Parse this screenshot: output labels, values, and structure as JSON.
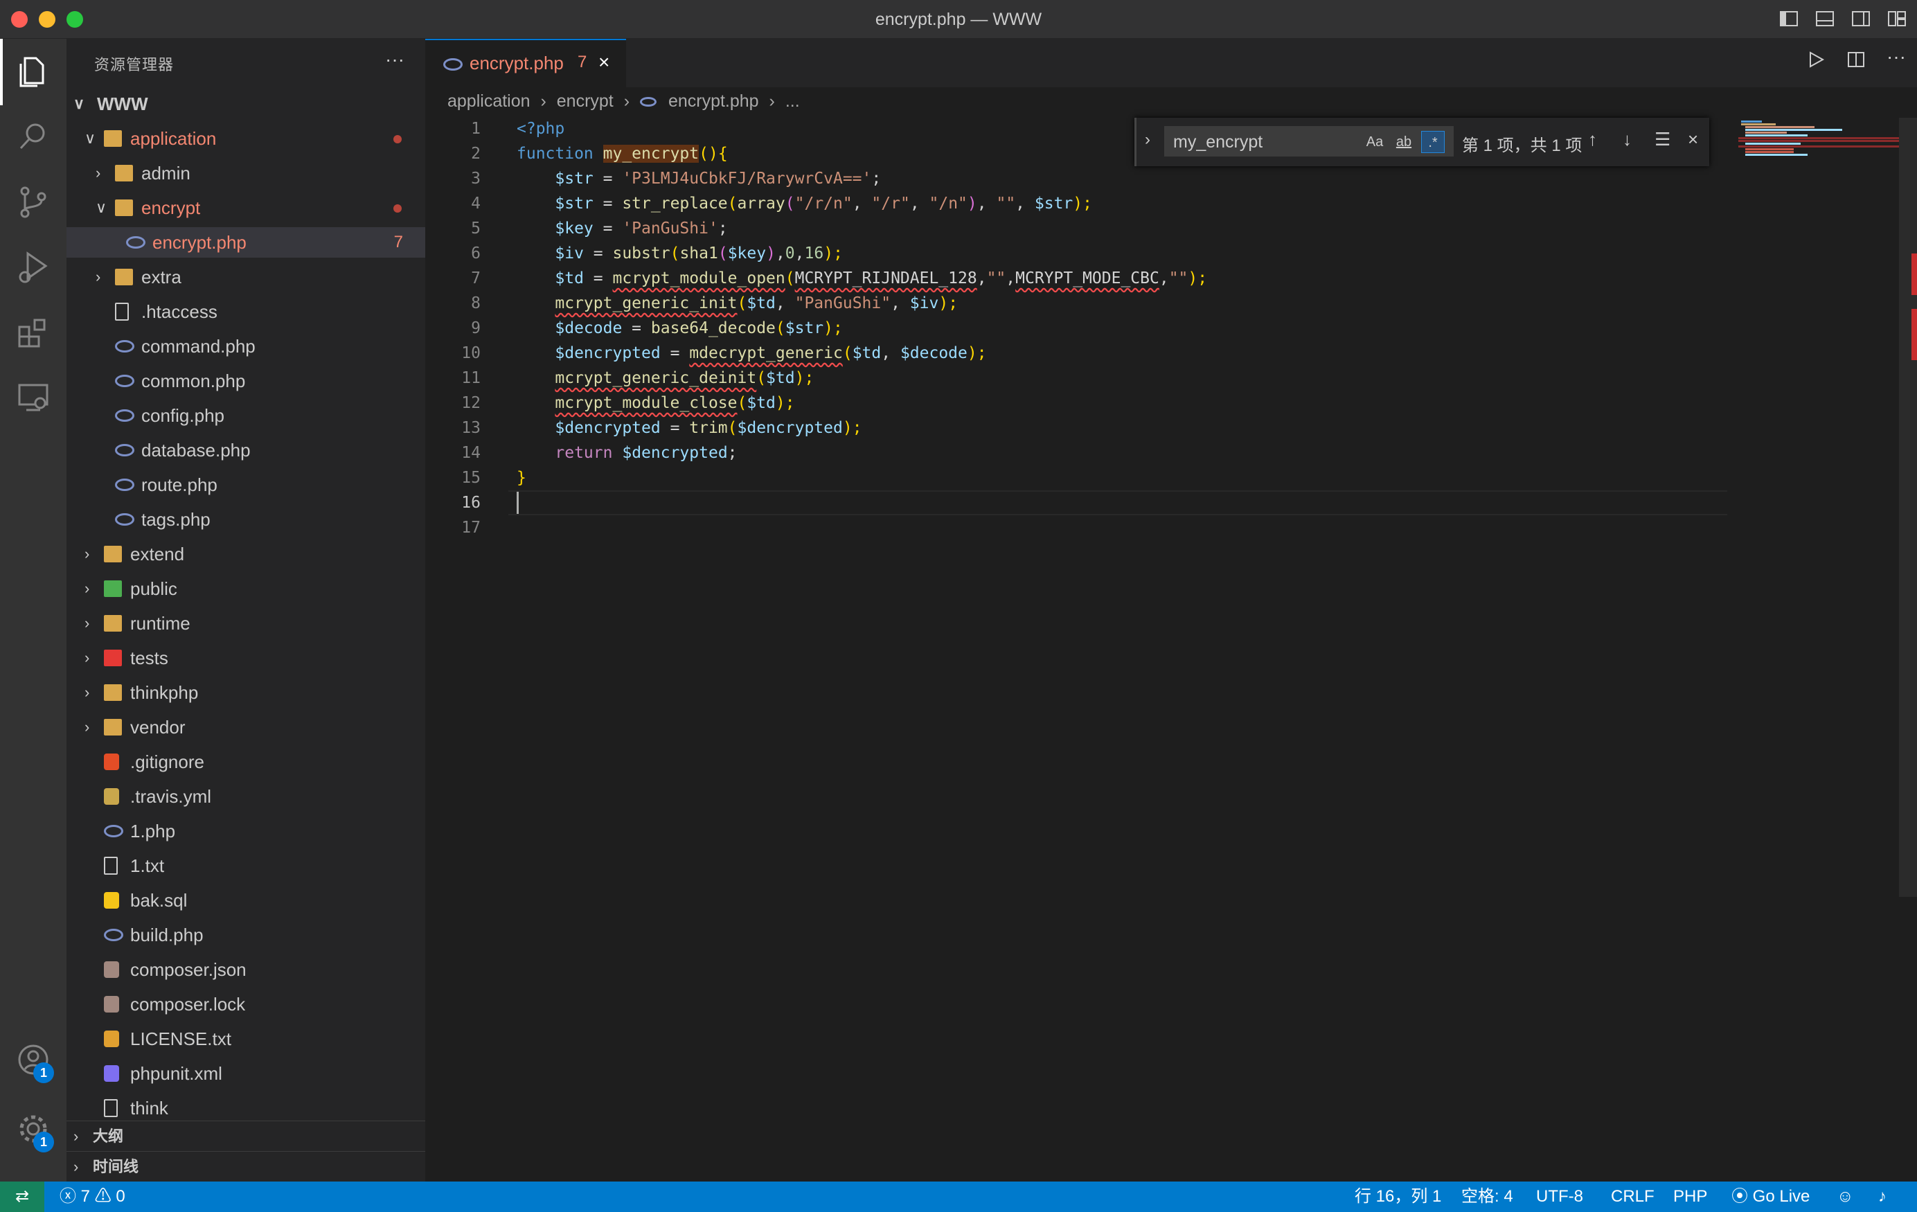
{
  "window": {
    "title": "encrypt.php — WWW"
  },
  "sidebar": {
    "header": "资源管理器",
    "more": "···",
    "tree": [
      {
        "label": "WWW",
        "chevron": "∨",
        "kind": "root"
      },
      {
        "label": "application",
        "chevron": "∨",
        "kind": "folder-open",
        "modified": true
      },
      {
        "label": "admin",
        "chevron": "›",
        "kind": "folder"
      },
      {
        "label": "encrypt",
        "chevron": "∨",
        "kind": "folder-open",
        "modified": true
      },
      {
        "label": "encrypt.php",
        "kind": "php",
        "problems": "7",
        "selected": true
      },
      {
        "label": "extra",
        "chevron": "›",
        "kind": "folder"
      },
      {
        "label": ".htaccess",
        "kind": "file"
      },
      {
        "label": "command.php",
        "kind": "php"
      },
      {
        "label": "common.php",
        "kind": "php"
      },
      {
        "label": "config.php",
        "kind": "php"
      },
      {
        "label": "database.php",
        "kind": "php"
      },
      {
        "label": "route.php",
        "kind": "php"
      },
      {
        "label": "tags.php",
        "kind": "php"
      },
      {
        "label": "extend",
        "chevron": "›",
        "kind": "folder"
      },
      {
        "label": "public",
        "chevron": "›",
        "kind": "folder-public"
      },
      {
        "label": "runtime",
        "chevron": "›",
        "kind": "folder"
      },
      {
        "label": "tests",
        "chevron": "›",
        "kind": "folder-tests"
      },
      {
        "label": "thinkphp",
        "chevron": "›",
        "kind": "folder"
      },
      {
        "label": "vendor",
        "chevron": "›",
        "kind": "folder"
      },
      {
        "label": ".gitignore",
        "kind": "git"
      },
      {
        "label": ".travis.yml",
        "kind": "travis"
      },
      {
        "label": "1.php",
        "kind": "php"
      },
      {
        "label": "1.txt",
        "kind": "txt"
      },
      {
        "label": "bak.sql",
        "kind": "sql"
      },
      {
        "label": "build.php",
        "kind": "php"
      },
      {
        "label": "composer.json",
        "kind": "composer"
      },
      {
        "label": "composer.lock",
        "kind": "composer"
      },
      {
        "label": "LICENSE.txt",
        "kind": "license"
      },
      {
        "label": "phpunit.xml",
        "kind": "xml"
      },
      {
        "label": "think",
        "kind": "file"
      }
    ],
    "outline": "大纲",
    "timeline": "时间线"
  },
  "activitybar": {
    "accounts_badge": "1",
    "settings_badge": "1"
  },
  "editor": {
    "tab": {
      "label": "encrypt.php",
      "problems": "7",
      "close": "×"
    },
    "breadcrumb": [
      "application",
      "encrypt",
      "encrypt.php",
      "..."
    ],
    "breadcrumb_sep": "›",
    "line_numbers": [
      "1",
      "2",
      "3",
      "4",
      "5",
      "6",
      "7",
      "8",
      "9",
      "10",
      "11",
      "12",
      "13",
      "14",
      "15",
      "16",
      "17"
    ],
    "current_line": "16",
    "code": {
      "l1_open": "<?php",
      "l2_kw": "function",
      "l2_name": "my_encrypt",
      "l2_parens": "()",
      "l2_brace": "{",
      "l3_var": "$str",
      "l3_eq": " = ",
      "l3_str": "'P3LMJ4uCbkFJ/RarywrCvA=='",
      "l3_end": ";",
      "l4_var": "$str",
      "l4_eq": " = ",
      "l4_fn": "str_replace",
      "l4_open": "(",
      "l4_fn2": "array",
      "l4_open2": "(",
      "l4_s1": "\"/r/n\"",
      "l4_c1": ", ",
      "l4_s2": "\"/r\"",
      "l4_c2": ", ",
      "l4_s3": "\"/n\"",
      "l4_close2": ")",
      "l4_c3": ", ",
      "l4_s4": "\"\"",
      "l4_c4": ", ",
      "l4_var2": "$str",
      "l4_close": ");",
      "l5_var": "$key",
      "l5_eq": " = ",
      "l5_str": "'PanGuShi'",
      "l5_end": ";",
      "l6_var": "$iv",
      "l6_eq": " = ",
      "l6_fn": "substr",
      "l6_open": "(",
      "l6_fn2": "sha1",
      "l6_open2": "(",
      "l6_var2": "$key",
      "l6_close2": ")",
      "l6_c1": ",",
      "l6_n1": "0",
      "l6_c2": ",",
      "l6_n2": "16",
      "l6_close": ");",
      "l7_var": "$td",
      "l7_eq": " = ",
      "l7_fn": "mcrypt_module_open",
      "l7_open": "(",
      "l7_const1": "MCRYPT_RIJNDAEL_128",
      "l7_c1": ",",
      "l7_s1": "\"\"",
      "l7_c2": ",",
      "l7_const2": "MCRYPT_MODE_CBC",
      "l7_c3": ",",
      "l7_s2": "\"\"",
      "l7_close": ");",
      "l8_fn": "mcrypt_generic_init",
      "l8_open": "(",
      "l8_var1": "$td",
      "l8_c1": ", ",
      "l8_str": "\"PanGuShi\"",
      "l8_c2": ", ",
      "l8_var2": "$iv",
      "l8_close": ");",
      "l9_var": "$decode",
      "l9_eq": " = ",
      "l9_fn": "base64_decode",
      "l9_open": "(",
      "l9_var2": "$str",
      "l9_close": ");",
      "l10_var": "$dencrypted",
      "l10_eq": " = ",
      "l10_fn": "mdecrypt_generic",
      "l10_open": "(",
      "l10_var1": "$td",
      "l10_c1": ", ",
      "l10_var2": "$decode",
      "l10_close": ");",
      "l11_fn": "mcrypt_generic_deinit",
      "l11_open": "(",
      "l11_var": "$td",
      "l11_close": ");",
      "l12_fn": "mcrypt_module_close",
      "l12_open": "(",
      "l12_var": "$td",
      "l12_close": ");",
      "l13_var": "$dencrypted",
      "l13_eq": " = ",
      "l13_fn": "trim",
      "l13_open": "(",
      "l13_var2": "$dencrypted",
      "l13_close": ");",
      "l14_kw": "return",
      "l14_var": "$dencrypted",
      "l14_end": ";",
      "l15_brace": "}"
    },
    "find": {
      "value": "my_encrypt",
      "case_label": "Aa",
      "word_label": "ab",
      "regex_label": ".*",
      "count": "第 1 项，共 1 项"
    }
  },
  "statusbar": {
    "errors": "7",
    "warnings": "0",
    "position": "行 16，列 1",
    "spaces": "空格: 4",
    "encoding": "UTF-8",
    "eol": "CRLF",
    "language": "PHP",
    "golive": "Go Live"
  },
  "colors": {
    "accent": "#007acc",
    "error": "#f48771",
    "tab_border": "#0078d4"
  }
}
